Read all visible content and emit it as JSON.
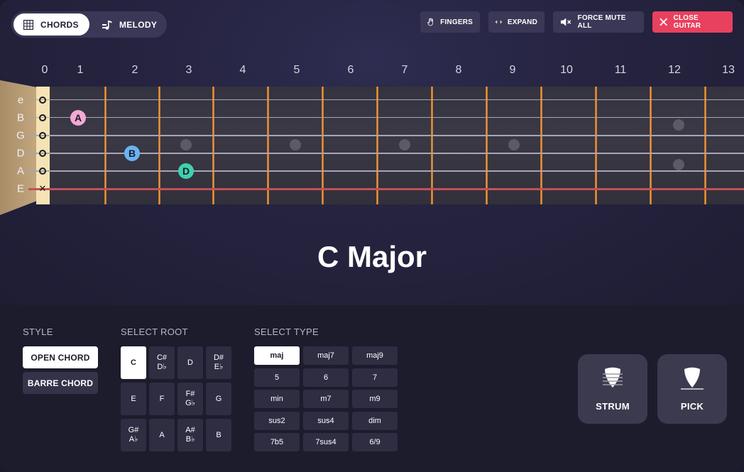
{
  "mode_toggle": {
    "chords_label": "CHORDS",
    "melody_label": "MELODY"
  },
  "toolbar": {
    "fingers_label": "FINGERS",
    "expand_label": "EXPAND",
    "force_mute_label": "FORCE MUTE ALL",
    "close_label": "CLOSE GUITAR"
  },
  "frets": {
    "numbers": [
      "0",
      "1",
      "2",
      "3",
      "4",
      "5",
      "6",
      "7",
      "8",
      "9",
      "10",
      "11",
      "12",
      "13"
    ]
  },
  "strings": {
    "labels": [
      "e",
      "B",
      "G",
      "D",
      "A",
      "E"
    ],
    "markers": [
      "open",
      "open",
      "open",
      "open",
      "open",
      "muted"
    ]
  },
  "notes": [
    {
      "label": "A",
      "string": "B",
      "fret": 1,
      "color": "#f4a8d4"
    },
    {
      "label": "B",
      "string": "D",
      "fret": 2,
      "color": "#6ab4f0"
    },
    {
      "label": "D",
      "string": "A",
      "fret": 3,
      "color": "#3ed1b0"
    }
  ],
  "chord_name": "C Major",
  "style": {
    "title": "STYLE",
    "options": [
      "OPEN CHORD",
      "BARRE CHORD"
    ],
    "selected": "OPEN CHORD"
  },
  "root": {
    "title": "SELECT ROOT",
    "options": [
      {
        "main": "C",
        "alt": ""
      },
      {
        "main": "C#",
        "alt": "D♭"
      },
      {
        "main": "D",
        "alt": ""
      },
      {
        "main": "D#",
        "alt": "E♭"
      },
      {
        "main": "E",
        "alt": ""
      },
      {
        "main": "F",
        "alt": ""
      },
      {
        "main": "F#",
        "alt": "G♭"
      },
      {
        "main": "G",
        "alt": ""
      },
      {
        "main": "G#",
        "alt": "A♭"
      },
      {
        "main": "A",
        "alt": ""
      },
      {
        "main": "A#",
        "alt": "B♭"
      },
      {
        "main": "B",
        "alt": ""
      }
    ],
    "selected": "C"
  },
  "type": {
    "title": "SELECT TYPE",
    "options": [
      "maj",
      "maj7",
      "maj9",
      "5",
      "6",
      "7",
      "min",
      "m7",
      "m9",
      "sus2",
      "sus4",
      "dim",
      "7b5",
      "7sus4",
      "6/9"
    ],
    "selected": "maj"
  },
  "play": {
    "strum_label": "STRUM",
    "pick_label": "PICK"
  },
  "colors": {
    "accent_close": "#e8415e",
    "nut": "#f5e3b5",
    "fret_wire": "#f0a64a",
    "muted_string": "#c25157"
  }
}
